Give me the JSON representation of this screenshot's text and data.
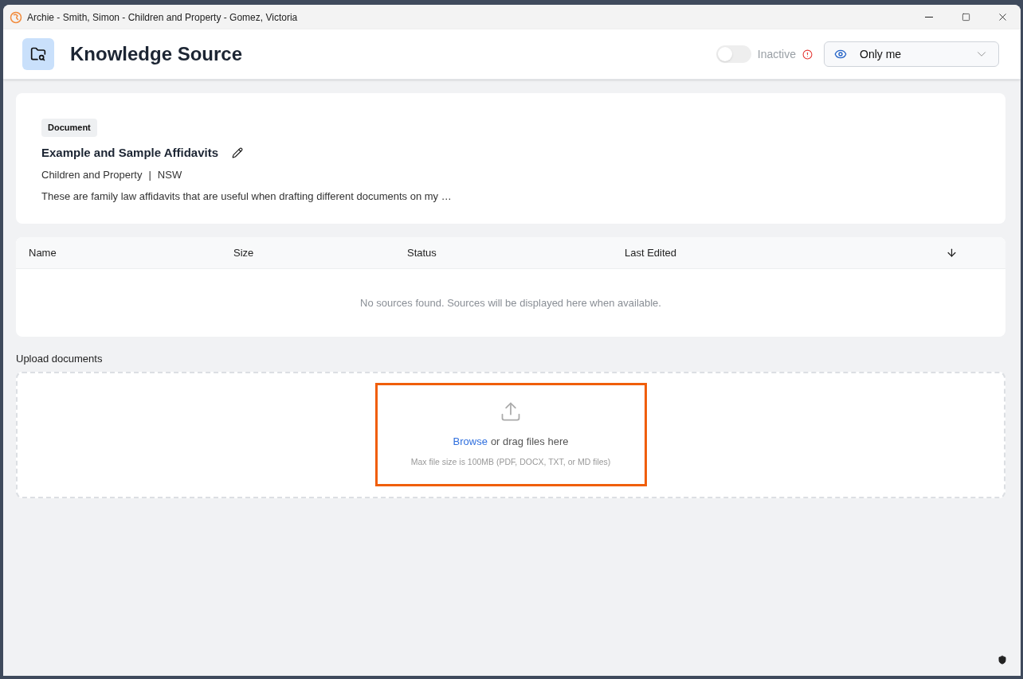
{
  "window": {
    "title": "Archie - Smith, Simon - Children and Property - Gomez, Victoria"
  },
  "header": {
    "title": "Knowledge Source",
    "status_toggle": {
      "on": false,
      "label": "Inactive"
    },
    "visibility": {
      "value": "Only me"
    }
  },
  "source": {
    "badge": "Document",
    "title": "Example and Sample Affidavits",
    "category": "Children and Property",
    "separator": "|",
    "region": "NSW",
    "description": "These are family law affidavits that are useful when drafting different documents on my …"
  },
  "table": {
    "columns": [
      "Name",
      "Size",
      "Status",
      "Last Edited"
    ],
    "empty_message": "No sources found. Sources will be displayed here when available."
  },
  "upload": {
    "label": "Upload documents",
    "browse_link": "Browse",
    "prompt": "or drag files here",
    "hint": "Max file size is 100MB (PDF, DOCX, TXT, or MD files)",
    "highlighted": true
  }
}
